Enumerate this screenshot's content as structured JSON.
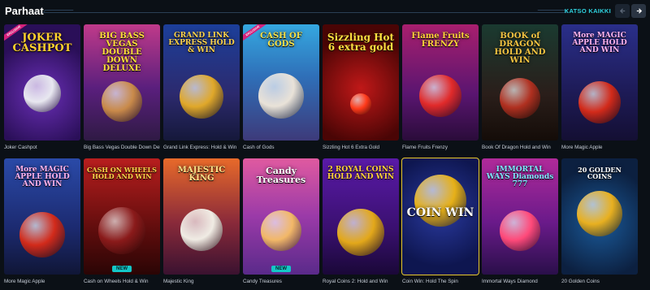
{
  "header": {
    "title": "Parhaat",
    "see_all_label": "KATSO KAIKKI"
  },
  "badges": {
    "new": "NEW",
    "exclusive": "EXCLUSIVE"
  },
  "colors": {
    "accent": "#2fd3e0",
    "selected_outline": "#e9c82e",
    "new_badge": "#14c7c7"
  },
  "games": [
    {
      "name": "Joker Cashpot",
      "logo": "JOKER CASHPOT",
      "exclusive": true
    },
    {
      "name": "Big Bass Vegas Double Down Deluxe",
      "logo": "BIG BASS VEGAS DOUBLE DOWN DELUXE"
    },
    {
      "name": "Grand Link Express: Hold & Win",
      "logo": "GRAND LINK EXPRESS HOLD & WIN"
    },
    {
      "name": "Cash of Gods",
      "logo": "CASH OF GODS",
      "exclusive": true
    },
    {
      "name": "Sizzling Hot 6 Extra Gold",
      "logo": "Sizzling Hot 6 extra gold"
    },
    {
      "name": "Flame Fruits Frenzy",
      "logo": "Flame Fruits FRENZY"
    },
    {
      "name": "Book Of Dragon Hold and Win",
      "logo": "BOOK of DRAGON HOLD AND WIN"
    },
    {
      "name": "More Magic Apple",
      "logo": "More MAGIC APPLE HOLD AND WIN"
    },
    {
      "name": "More Magic Apple",
      "logo": "More MAGIC APPLE HOLD AND WIN"
    },
    {
      "name": "Cash on Wheels Hold & Win",
      "logo": "CASH ON WHEELS HOLD AND WIN",
      "new": true
    },
    {
      "name": "Majestic King",
      "logo": "MAJESTIC KING"
    },
    {
      "name": "Candy Treasures",
      "logo": "Candy Treasures",
      "new": true
    },
    {
      "name": "Royal Coins 2: Hold and Win",
      "logo": "2 ROYAL COINS HOLD AND WIN"
    },
    {
      "name": "Coin Win: Hold The Spin",
      "logo": "COIN WIN",
      "selected": true
    },
    {
      "name": "Immortal Ways Diamond",
      "logo": "IMMORTAL WAYS Diamonds 777"
    },
    {
      "name": "20 Golden Coins",
      "logo": "20 GOLDEN COINS"
    }
  ]
}
